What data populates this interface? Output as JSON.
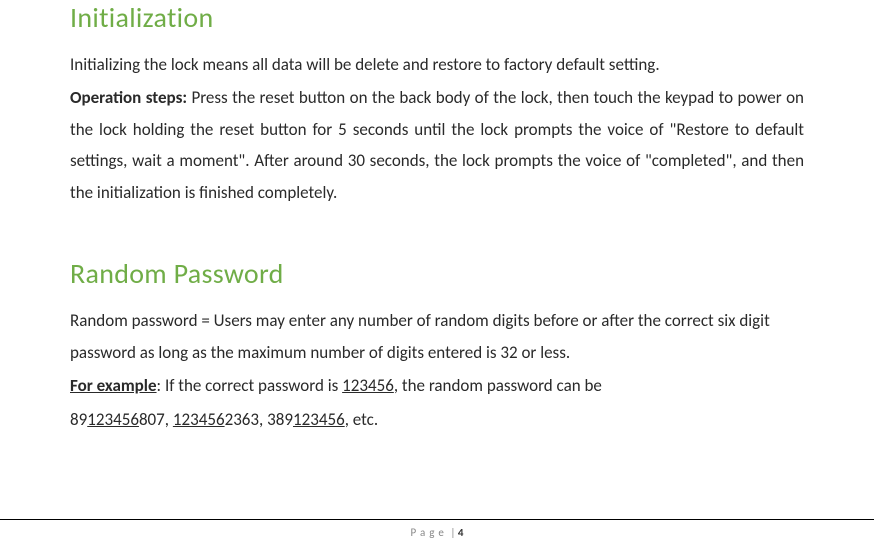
{
  "section1": {
    "heading": "Initialization",
    "para1": "Initializing the lock means all data will be delete and restore to factory default setting.",
    "operation_label": "Operation steps:",
    "operation_text": " Press the reset button on the back body of the lock, then touch the keypad to power on the lock holding the reset button for 5 seconds until the lock prompts the voice of \"Restore to default settings, wait a moment\". After around 30 seconds, the lock prompts the voice of \"completed\", and then the initialization is finished completely."
  },
  "section2": {
    "heading": "Random Password",
    "para1": "Random password = Users may enter any number of random digits before or after the correct six digit password as long as the maximum number of digits entered is 32 or less.",
    "example_label": "For example",
    "example_text1": ": If the correct password is ",
    "example_pw": "123456",
    "example_text2": ", the random password can be",
    "ex_a": "89",
    "ex_a_pw": "123456",
    "ex_a_suffix": "807, ",
    "ex_b_pw": "123456",
    "ex_b_suffix": "2363, 389",
    "ex_c_pw": "123456",
    "ex_c_suffix": ", etc."
  },
  "footer": {
    "page_label": "Page",
    "separator": " | ",
    "page_number": "4"
  }
}
